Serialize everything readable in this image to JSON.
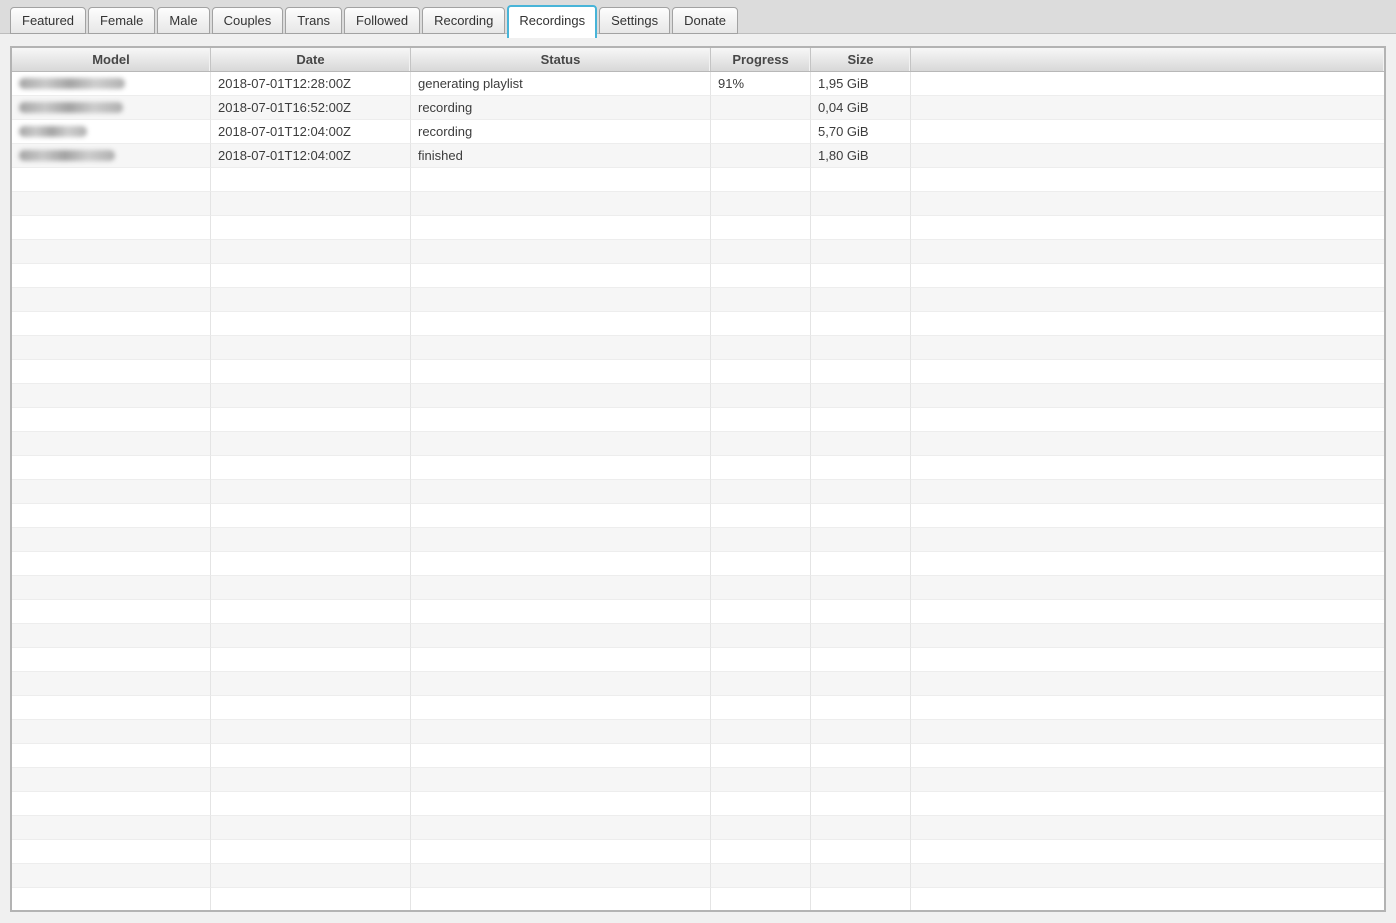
{
  "tabs": [
    {
      "label": "Featured",
      "selected": false
    },
    {
      "label": "Female",
      "selected": false
    },
    {
      "label": "Male",
      "selected": false
    },
    {
      "label": "Couples",
      "selected": false
    },
    {
      "label": "Trans",
      "selected": false
    },
    {
      "label": "Followed",
      "selected": false
    },
    {
      "label": "Recording",
      "selected": false
    },
    {
      "label": "Recordings",
      "selected": true
    },
    {
      "label": "Settings",
      "selected": false
    },
    {
      "label": "Donate",
      "selected": false
    }
  ],
  "table": {
    "columns": [
      "Model",
      "Date",
      "Status",
      "Progress",
      "Size",
      ""
    ],
    "rows": [
      {
        "model_redacted": true,
        "model_redacted_width": 106,
        "date": "2018-07-01T12:28:00Z",
        "status": "generating playlist",
        "progress": "91%",
        "size": "1,95 GiB"
      },
      {
        "model_redacted": true,
        "model_redacted_width": 104,
        "date": "2018-07-01T16:52:00Z",
        "status": "recording",
        "progress": "",
        "size": "0,04 GiB"
      },
      {
        "model_redacted": true,
        "model_redacted_width": 68,
        "date": "2018-07-01T12:04:00Z",
        "status": "recording",
        "progress": "",
        "size": "5,70 GiB"
      },
      {
        "model_redacted": true,
        "model_redacted_width": 96,
        "date": "2018-07-01T12:04:00Z",
        "status": "finished",
        "progress": "",
        "size": "1,80 GiB"
      }
    ],
    "empty_row_count": 31
  },
  "colors": {
    "accent_selected_tab": "#48b4d8",
    "tab_strip_bg": "#dcdcdc",
    "page_bg": "#f0f0f0",
    "row_stripe": "#f6f6f6",
    "table_border": "#b3b3b3",
    "header_text": "#474747",
    "body_text": "#3c3c3c"
  }
}
